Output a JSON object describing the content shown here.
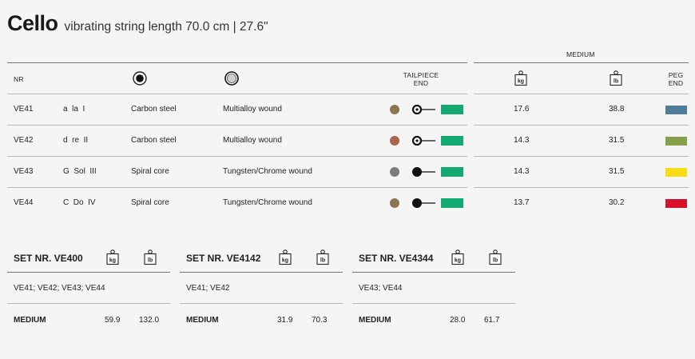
{
  "header": {
    "title": "Cello",
    "subtitle": "vibrating string length 70.0 cm | 27.6\""
  },
  "table": {
    "col_nr": "NR",
    "col_tailpiece_line1": "TAILPIECE",
    "col_tailpiece_line2": "END",
    "tension_label": "MEDIUM",
    "col_peg_line1": "PEG",
    "col_peg_line2": "END",
    "core_icon": "core-solid-icon",
    "winding_icon": "winding-ring-icon",
    "rows": [
      {
        "nr": "VE41",
        "note": "a  la  I",
        "core": "Carbon steel",
        "winding": "Multialloy wound",
        "ball_color": "#8b7650",
        "loop": true,
        "kg": "17.6",
        "lb": "38.8",
        "peg_color": "#4e7e9a"
      },
      {
        "nr": "VE42",
        "note": "d  re  II",
        "core": "Carbon steel",
        "winding": "Multialloy wound",
        "ball_color": "#ac6448",
        "loop": true,
        "kg": "14.3",
        "lb": "31.5",
        "peg_color": "#85a04a"
      },
      {
        "nr": "VE43",
        "note": "G  Sol  III",
        "core": "Spiral core",
        "winding": "Tungsten/Chrome wound",
        "ball_color": "#7c7c7c",
        "loop": false,
        "kg": "14.3",
        "lb": "31.5",
        "peg_color": "#f7dc14"
      },
      {
        "nr": "VE44",
        "note": "C  Do  IV",
        "core": "Spiral core",
        "winding": "Tungsten/Chrome wound",
        "ball_color": "#8b7650",
        "loop": false,
        "kg": "13.7",
        "lb": "30.2",
        "peg_color": "#d8102a"
      }
    ]
  },
  "tailpiece_color": "#12aa70",
  "unit_kg": "kg",
  "unit_lb": "lb",
  "sets": [
    {
      "title": "SET NR. VE400",
      "strings": "VE41; VE42; VE43; VE44",
      "tension": "MEDIUM",
      "kg": "59.9",
      "lb": "132.0"
    },
    {
      "title": "SET NR. VE4142",
      "strings": "VE41; VE42",
      "tension": "MEDIUM",
      "kg": "31.9",
      "lb": "70.3"
    },
    {
      "title": "SET NR. VE4344",
      "strings": "VE43; VE44",
      "tension": "MEDIUM",
      "kg": "28.0",
      "lb": "61.7"
    }
  ]
}
